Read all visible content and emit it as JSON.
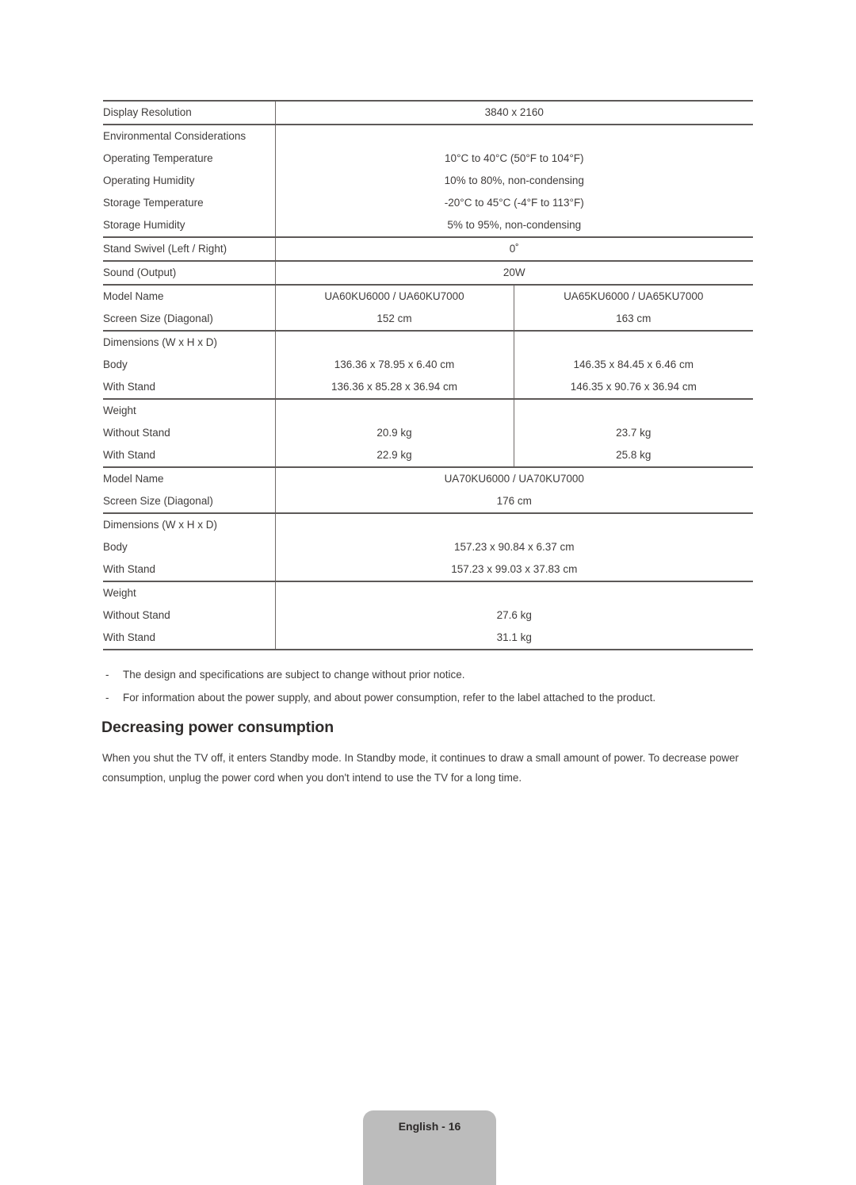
{
  "document": {
    "page_footer": "English - 16"
  },
  "spec_table": {
    "groups": [
      {
        "id": "display",
        "rows": [
          {
            "label": "Display Resolution",
            "span": "full",
            "values": [
              "3840 x 2160"
            ]
          }
        ]
      },
      {
        "id": "environmental",
        "rows": [
          {
            "label": "Environmental Considerations",
            "span": "full",
            "values": [
              ""
            ]
          },
          {
            "label": "Operating Temperature",
            "span": "full",
            "values": [
              "10°C to 40°C (50°F to 104°F)"
            ]
          },
          {
            "label": "Operating Humidity",
            "span": "full",
            "values": [
              "10% to 80%, non-condensing"
            ]
          },
          {
            "label": "Storage Temperature",
            "span": "full",
            "values": [
              "-20°C to 45°C (-4°F to 113°F)"
            ]
          },
          {
            "label": "Storage Humidity",
            "span": "full",
            "values": [
              "5% to 95%, non-condensing"
            ]
          }
        ]
      },
      {
        "id": "swivel",
        "rows": [
          {
            "label": "Stand Swivel (Left / Right)",
            "span": "full",
            "values": [
              "0˚"
            ]
          }
        ]
      },
      {
        "id": "sound",
        "rows": [
          {
            "label": "Sound (Output)",
            "span": "full",
            "values": [
              "20W"
            ]
          }
        ]
      },
      {
        "id": "models-60-65",
        "rows": [
          {
            "label": "Model Name",
            "span": "split",
            "values": [
              "UA60KU6000 / UA60KU7000",
              "UA65KU6000 / UA65KU7000"
            ]
          },
          {
            "label": "Screen Size (Diagonal)",
            "span": "split",
            "values": [
              "152 cm",
              "163 cm"
            ]
          }
        ]
      },
      {
        "id": "dimensions-60-65",
        "rows": [
          {
            "label": "Dimensions (W x H x D)",
            "span": "split",
            "values": [
              "",
              ""
            ]
          },
          {
            "label": "Body",
            "span": "split",
            "values": [
              "136.36 x 78.95 x 6.40 cm",
              "146.35 x 84.45 x 6.46 cm"
            ]
          },
          {
            "label": "With Stand",
            "span": "split",
            "values": [
              "136.36 x 85.28 x 36.94 cm",
              "146.35 x 90.76 x 36.94 cm"
            ]
          }
        ]
      },
      {
        "id": "weight-60-65",
        "rows": [
          {
            "label": "Weight",
            "span": "split",
            "values": [
              "",
              ""
            ]
          },
          {
            "label": "Without Stand",
            "span": "split",
            "values": [
              "20.9 kg",
              "23.7 kg"
            ]
          },
          {
            "label": "With Stand",
            "span": "split",
            "values": [
              "22.9 kg",
              "25.8 kg"
            ]
          }
        ]
      },
      {
        "id": "models-70",
        "rows": [
          {
            "label": "Model Name",
            "span": "full",
            "values": [
              "UA70KU6000 / UA70KU7000"
            ]
          },
          {
            "label": "Screen Size (Diagonal)",
            "span": "full",
            "values": [
              "176 cm"
            ]
          }
        ]
      },
      {
        "id": "dimensions-70",
        "rows": [
          {
            "label": "Dimensions (W x H x D)",
            "span": "full",
            "values": [
              ""
            ]
          },
          {
            "label": "Body",
            "span": "full",
            "values": [
              "157.23 x 90.84 x 6.37 cm"
            ]
          },
          {
            "label": "With Stand",
            "span": "full",
            "values": [
              "157.23 x 99.03 x 37.83 cm"
            ]
          }
        ]
      },
      {
        "id": "weight-70",
        "rows": [
          {
            "label": "Weight",
            "span": "full",
            "values": [
              ""
            ]
          },
          {
            "label": "Without Stand",
            "span": "full",
            "values": [
              "27.6 kg"
            ]
          },
          {
            "label": "With Stand",
            "span": "full",
            "values": [
              "31.1 kg"
            ]
          }
        ]
      }
    ]
  },
  "notes": {
    "dash": "-",
    "items": [
      "The design and specifications are subject to change without prior notice.",
      "For information about the power supply, and about power consumption, refer to the label attached to the product."
    ]
  },
  "section": {
    "heading": "Decreasing power consumption",
    "paragraph": "When you shut the TV off, it enters Standby mode. In Standby mode, it continues to draw a small amount of power. To decrease power consumption, unplug the power cord when you don't intend to use the TV for a long time."
  },
  "colors": {
    "text": "#3f3c3b",
    "heading": "#2f2c2b",
    "rule_thick": "#5d5958",
    "rule_thin": "#6f6a69",
    "footer_bg": "#bcbcbc"
  }
}
